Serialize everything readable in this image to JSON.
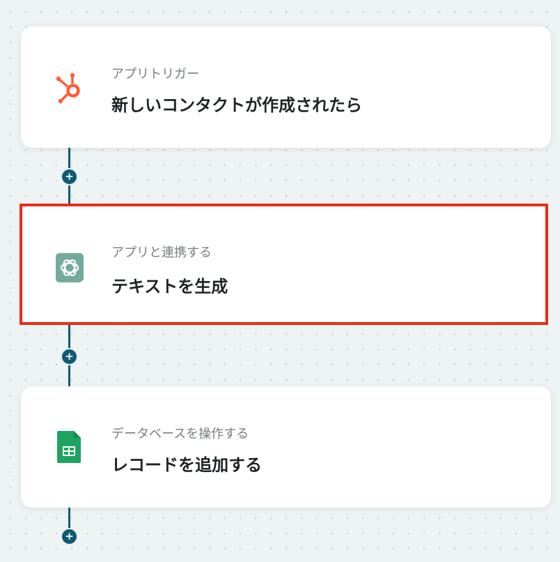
{
  "steps": [
    {
      "category": "アプリトリガー",
      "title": "新しいコンタクトが作成されたら",
      "icon": "hubspot-icon",
      "color": "#ff5c35"
    },
    {
      "category": "アプリと連携する",
      "title": "テキストを生成",
      "icon": "chatgpt-icon",
      "color": "#74aa9c"
    },
    {
      "category": "データベースを操作する",
      "title": "レコードを追加する",
      "icon": "google-sheets-icon",
      "color": "#1ea362"
    }
  ],
  "add_label": "+",
  "accent_color": "#0f5a73",
  "selected_border_color": "#ef2a14"
}
